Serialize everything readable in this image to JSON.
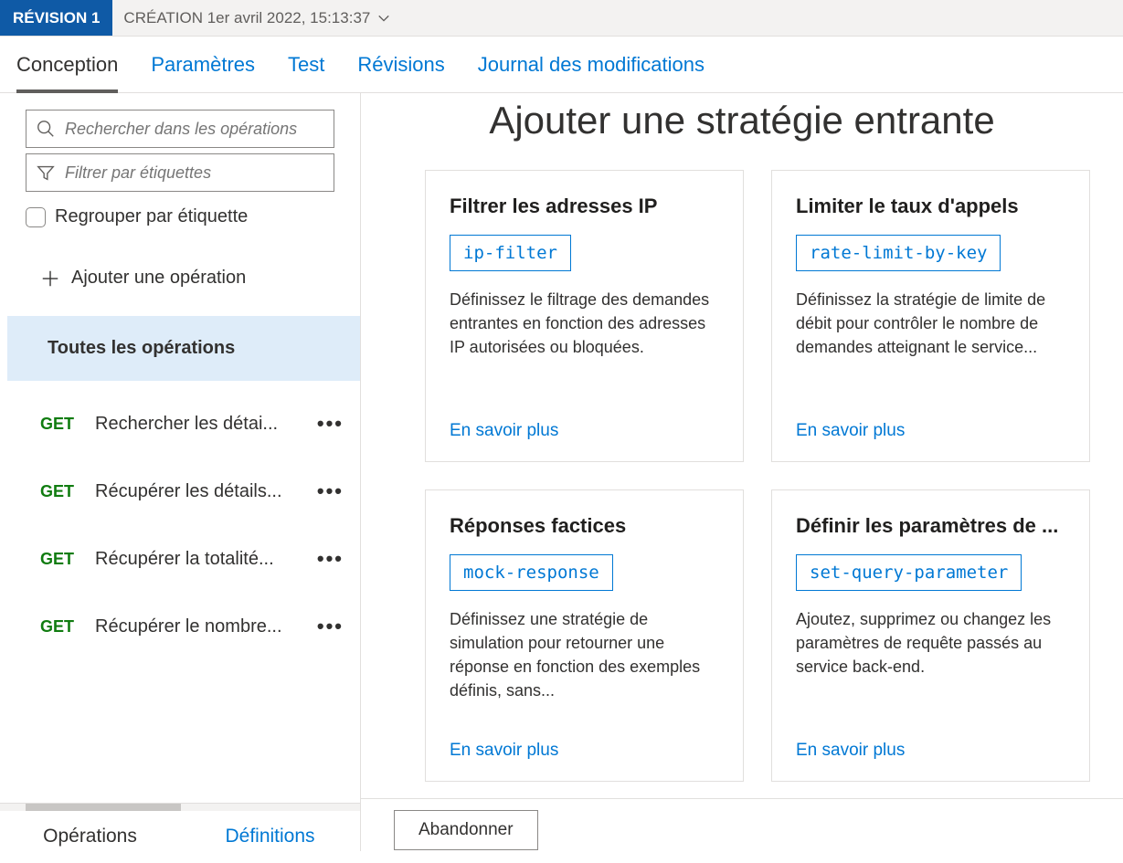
{
  "header": {
    "revision_label": "RÉVISION 1",
    "creation_label": "CRÉATION 1er avril 2022, 15:13:37"
  },
  "tabs": {
    "design": "Conception",
    "settings": "Paramètres",
    "test": "Test",
    "revisions": "Révisions",
    "changelog": "Journal des modifications"
  },
  "sidebar": {
    "search_placeholder": "Rechercher dans les opérations",
    "filter_placeholder": "Filtrer par étiquettes",
    "group_label": "Regrouper par étiquette",
    "add_op_label": "Ajouter une opération",
    "all_ops_label": "Toutes les opérations",
    "ops": [
      {
        "method": "GET",
        "name": "Rechercher les détai..."
      },
      {
        "method": "GET",
        "name": "Récupérer les détails..."
      },
      {
        "method": "GET",
        "name": "Récupérer la totalité..."
      },
      {
        "method": "GET",
        "name": "Récupérer le nombre..."
      }
    ],
    "bottom_tabs": {
      "operations": "Opérations",
      "definitions": "Définitions"
    }
  },
  "main": {
    "title": "Ajouter une stratégie entrante",
    "cards": [
      {
        "title": "Filtrer les adresses IP",
        "code": "ip-filter",
        "desc": "Définissez le filtrage des demandes entrantes en fonction des adresses IP autorisées ou bloquées.",
        "link": "En savoir plus"
      },
      {
        "title": "Limiter le taux d'appels",
        "code": "rate-limit-by-key",
        "desc": "Définissez la stratégie de limite de débit pour contrôler le nombre de demandes atteignant le service...",
        "link": "En savoir plus"
      },
      {
        "title": "Réponses factices",
        "code": "mock-response",
        "desc": "Définissez une stratégie de simulation pour retourner une réponse en fonction des exemples définis, sans...",
        "link": "En savoir plus"
      },
      {
        "title": "Définir les paramètres de ...",
        "code": "set-query-parameter",
        "desc": "Ajoutez, supprimez ou changez les paramètres de requête passés au service back-end.",
        "link": "En savoir plus"
      }
    ],
    "abandon_label": "Abandonner"
  }
}
